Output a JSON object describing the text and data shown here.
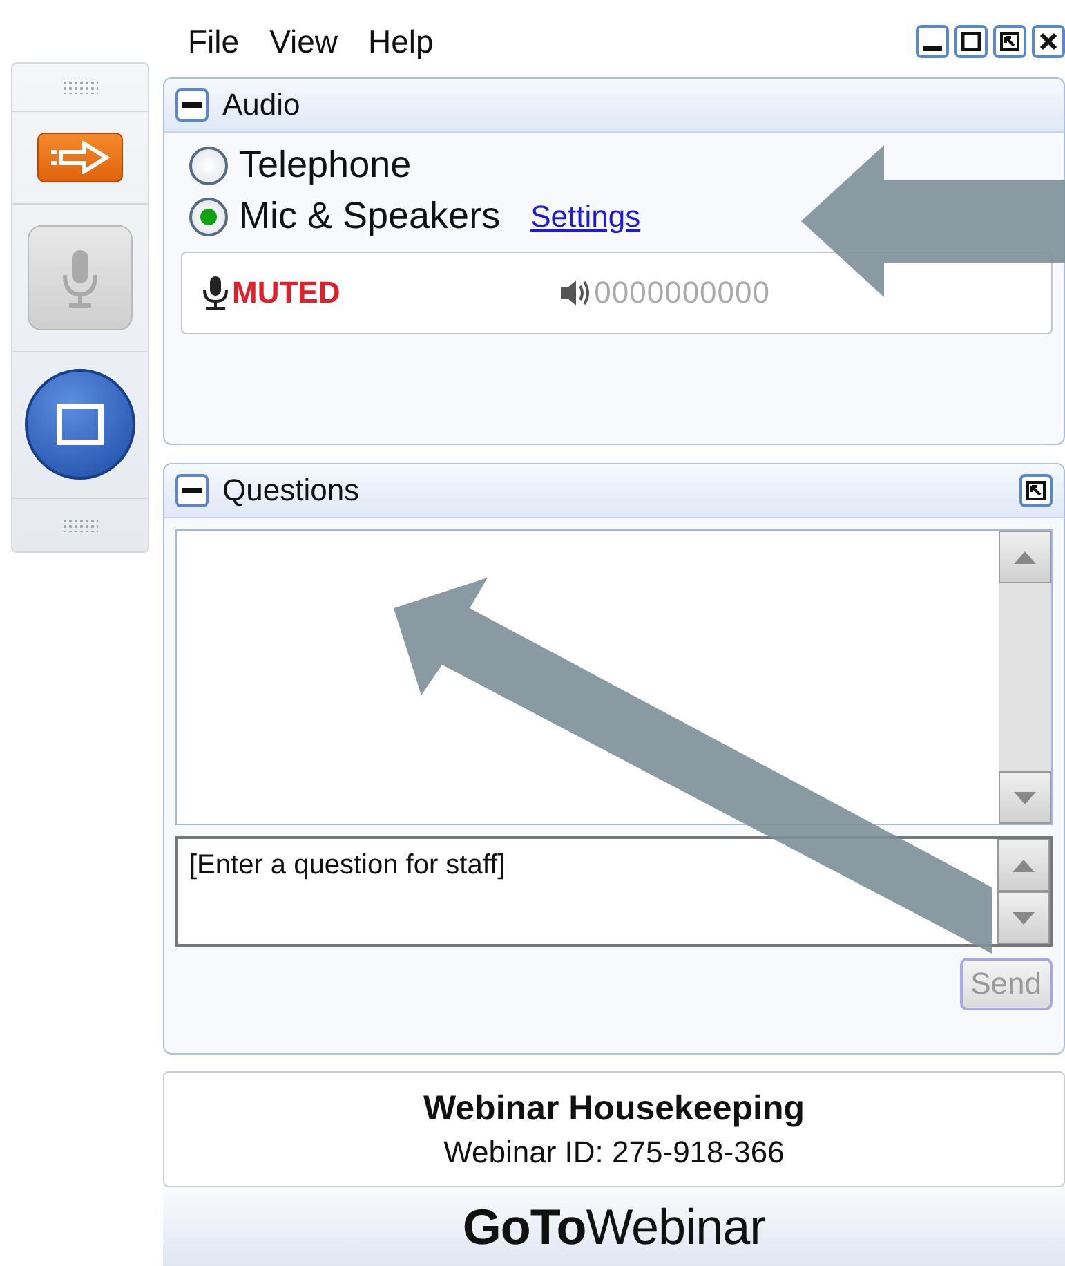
{
  "menu": [
    "File",
    "View",
    "Help"
  ],
  "audio": {
    "title": "Audio",
    "expanded": true,
    "options": [
      {
        "label": "Telephone",
        "selected": false
      },
      {
        "label": "Mic & Speakers",
        "selected": true
      }
    ],
    "settings_link": "Settings",
    "mic_status": "MUTED",
    "speaker_level_text": "0000000000"
  },
  "questions": {
    "title": "Questions",
    "expanded": true,
    "placeholder": "[Enter a question for staff]",
    "send": "Send",
    "send_disabled": true
  },
  "info": {
    "title": "Webinar Housekeeping",
    "webinar_id": "Webinar ID: 275-918-366"
  },
  "logo": "**GoTo**Webinar"
}
